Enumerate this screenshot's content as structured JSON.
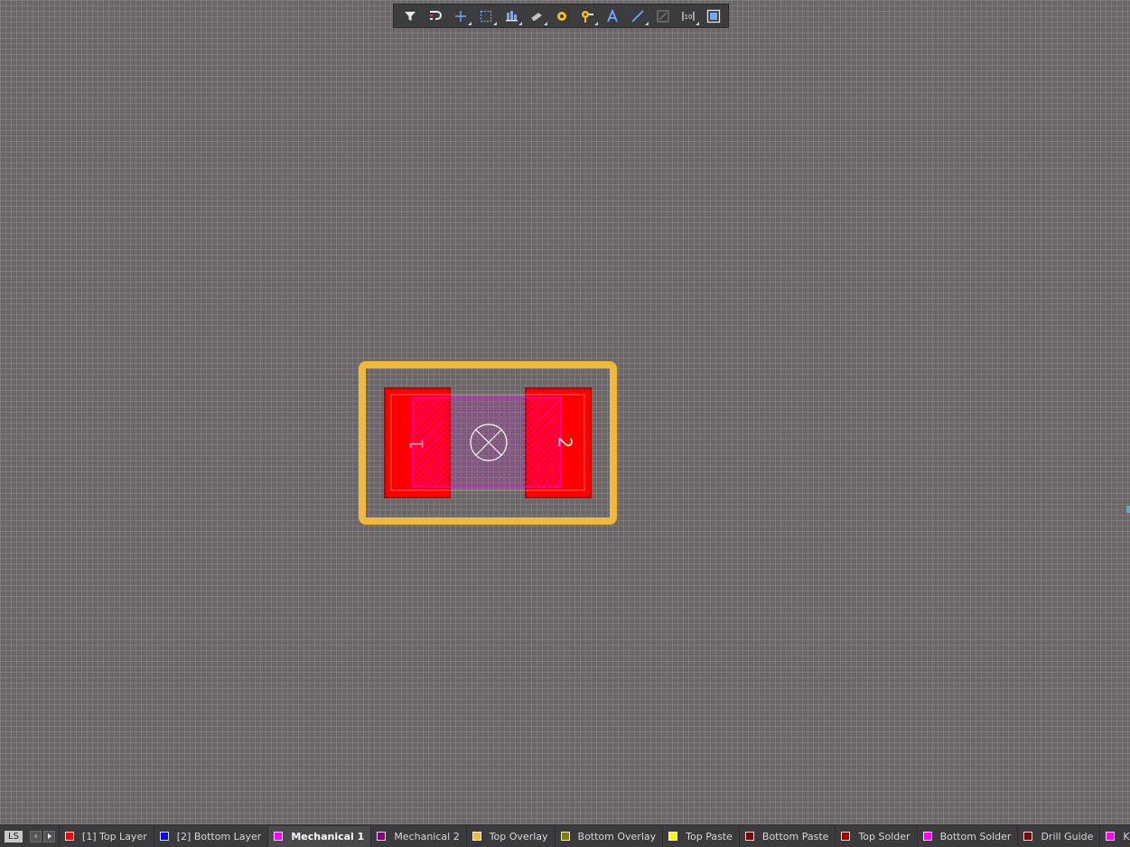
{
  "toolbar": {
    "buttons": [
      {
        "name": "filter-icon",
        "menu": false
      },
      {
        "name": "snap-magnet-icon",
        "menu": false
      },
      {
        "name": "crosshair-icon",
        "menu": true
      },
      {
        "name": "select-rect-icon",
        "menu": true
      },
      {
        "name": "align-icon",
        "menu": true
      },
      {
        "name": "component-icon",
        "menu": true
      },
      {
        "name": "pad-icon",
        "menu": false
      },
      {
        "name": "via-icon",
        "menu": true
      },
      {
        "name": "text-icon",
        "menu": false
      },
      {
        "name": "line-icon",
        "menu": true
      },
      {
        "name": "dimension-icon",
        "menu": false
      },
      {
        "name": "array-icon",
        "menu": true
      },
      {
        "name": "region-icon",
        "menu": false
      }
    ]
  },
  "footprint": {
    "pads": [
      {
        "label": "1"
      },
      {
        "label": "2"
      }
    ],
    "colors": {
      "overlay": "#f0b93a",
      "pad": "#ff0000",
      "pad_outline": "#c00000",
      "mechanical": "#ff00ff",
      "origin": "#ffffff"
    }
  },
  "layerbar": {
    "ls_label": "LS",
    "ls_color": "#ff00ff",
    "layers": [
      {
        "label": "[1] Top Layer",
        "color": "#ff0000",
        "active": false
      },
      {
        "label": "[2] Bottom Layer",
        "color": "#0000ff",
        "active": false
      },
      {
        "label": "Mechanical 1",
        "color": "#ff00ff",
        "active": true
      },
      {
        "label": "Mechanical 2",
        "color": "#800080",
        "active": false
      },
      {
        "label": "Top Overlay",
        "color": "#f0b93a",
        "active": false
      },
      {
        "label": "Bottom Overlay",
        "color": "#808000",
        "active": false
      },
      {
        "label": "Top Paste",
        "color": "#ffff00",
        "active": false
      },
      {
        "label": "Bottom Paste",
        "color": "#800000",
        "active": false
      },
      {
        "label": "Top Solder",
        "color": "#a00000",
        "active": false
      },
      {
        "label": "Bottom Solder",
        "color": "#ff00ff",
        "active": false
      },
      {
        "label": "Drill Guide",
        "color": "#800000",
        "active": false
      },
      {
        "label": "Keep-Out Layer",
        "color": "#ff00ff",
        "active": false
      }
    ]
  }
}
